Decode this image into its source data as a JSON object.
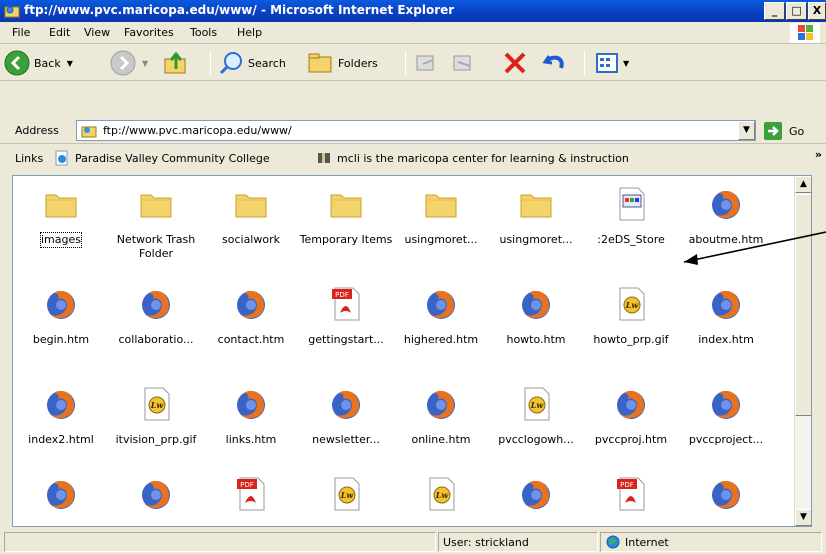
{
  "window": {
    "title": "ftp://www.pvc.maricopa.edu/www/ - Microsoft Internet Explorer",
    "minimize": "_",
    "maximize": "□",
    "close": "X"
  },
  "menu": [
    "File",
    "Edit",
    "View",
    "Favorites",
    "Tools",
    "Help"
  ],
  "toolbar": {
    "back_label": "Back",
    "search_label": "Search",
    "folders_label": "Folders"
  },
  "address": {
    "label": "Address",
    "value": "ftp://www.pvc.maricopa.edu/www/",
    "go_label": "Go"
  },
  "links": {
    "label": "Links",
    "items": [
      "Paradise Valley Community College",
      "mcli is the maricopa center for learning & instruction"
    ],
    "more": "»"
  },
  "files": [
    {
      "name": "images",
      "icon": "folder-icon"
    },
    {
      "name": "Network Trash Folder",
      "icon": "folder-icon"
    },
    {
      "name": "socialwork",
      "icon": "folder-icon"
    },
    {
      "name": "Temporary Items",
      "icon": "folder-icon"
    },
    {
      "name": "usingmoret...",
      "icon": "folder-icon"
    },
    {
      "name": "usingmoret...",
      "icon": "folder-icon"
    },
    {
      "name": ":2eDS_Store",
      "icon": "generic-file-icon"
    },
    {
      "name": "aboutme.htm",
      "icon": "firefox-html-icon"
    },
    {
      "name": "begin.htm",
      "icon": "firefox-html-icon"
    },
    {
      "name": "collaboratio...",
      "icon": "firefox-html-icon"
    },
    {
      "name": "contact.htm",
      "icon": "firefox-html-icon"
    },
    {
      "name": "gettingstart...",
      "icon": "pdf-icon"
    },
    {
      "name": "highered.htm",
      "icon": "firefox-html-icon"
    },
    {
      "name": "howto.htm",
      "icon": "firefox-html-icon"
    },
    {
      "name": "howto_prp.gif",
      "icon": "gif-image-icon"
    },
    {
      "name": "index.htm",
      "icon": "firefox-html-icon"
    },
    {
      "name": "index2.html",
      "icon": "firefox-html-icon"
    },
    {
      "name": "itvision_prp.gif",
      "icon": "gif-image-icon"
    },
    {
      "name": "links.htm",
      "icon": "firefox-html-icon"
    },
    {
      "name": "newsletter...",
      "icon": "firefox-html-icon"
    },
    {
      "name": "online.htm",
      "icon": "firefox-html-icon"
    },
    {
      "name": "pvcclogowh...",
      "icon": "gif-image-icon"
    },
    {
      "name": "pvccproj.htm",
      "icon": "firefox-html-icon"
    },
    {
      "name": "pvccproject...",
      "icon": "firefox-html-icon"
    },
    {
      "name": "",
      "icon": "firefox-html-icon"
    },
    {
      "name": "",
      "icon": "firefox-html-icon"
    },
    {
      "name": "",
      "icon": "pdf-icon"
    },
    {
      "name": "",
      "icon": "gif-image-icon"
    },
    {
      "name": "",
      "icon": "gif-image-icon"
    },
    {
      "name": "",
      "icon": "firefox-html-icon"
    },
    {
      "name": "",
      "icon": "pdf-icon"
    },
    {
      "name": "",
      "icon": "firefox-html-icon"
    }
  ],
  "status": {
    "user": "User: strickland",
    "zone": "Internet"
  },
  "colors": {
    "titlebar": "#0a4fd6",
    "folder": "#f3d36b",
    "pdf_red": "#d9241c"
  }
}
